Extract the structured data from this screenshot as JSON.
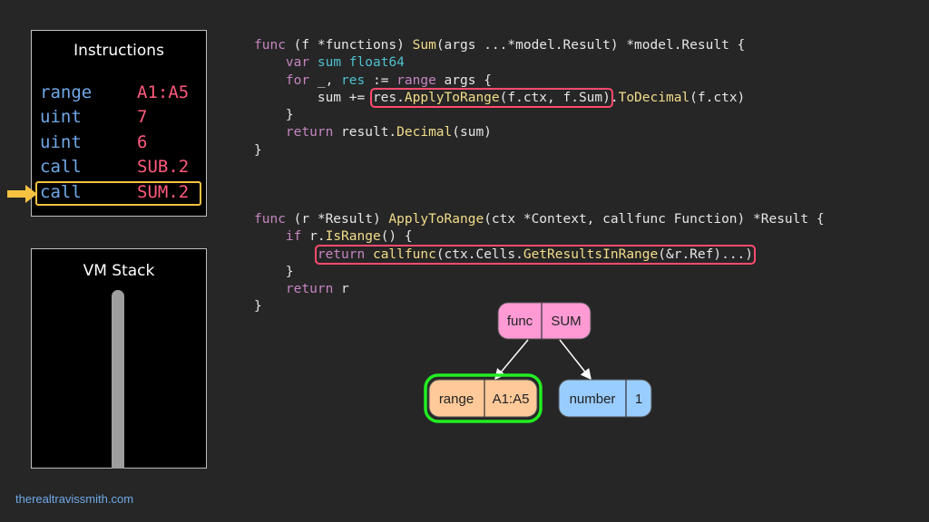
{
  "instructions": {
    "title": "Instructions",
    "rows": [
      {
        "op": "range",
        "arg": "A1:A5"
      },
      {
        "op": "uint",
        "arg": "7"
      },
      {
        "op": "uint",
        "arg": "6"
      },
      {
        "op": "call",
        "arg": "SUB.2"
      },
      {
        "op": "call",
        "arg": "SUM.2"
      }
    ],
    "current_index": 4
  },
  "stack": {
    "title": "VM Stack"
  },
  "code_sum": [
    "func (f *functions) Sum(args ...*model.Result) *model.Result {",
    "    var sum float64",
    "    for _, res := range args {",
    "        sum += res.ApplyToRange(f.ctx, f.Sum).ToDecimal(f.ctx)",
    "    }",
    "    return result.Decimal(sum)",
    "}"
  ],
  "code_apply": [
    "func (r *Result) ApplyToRange(ctx *Context, callfunc Function) *Result {",
    "    if r.IsRange() {",
    "        return callfunc(ctx.Cells.GetResultsInRange(&r.Ref)...)",
    "    }",
    "    return r",
    "}"
  ],
  "tree": {
    "root": {
      "type": "func",
      "value": "SUM"
    },
    "children": [
      {
        "type": "range",
        "value": "A1:A5"
      },
      {
        "type": "number",
        "value": "1"
      }
    ]
  },
  "footer": "therealtravissmith.com",
  "colors": {
    "func_node": "#ff9ad5",
    "range_node": "#ffc999",
    "number_node": "#99ccff",
    "active_highlight": "#22ee22",
    "code_highlight": "#ff4b6e",
    "pointer_arrow": "#f5c242"
  }
}
